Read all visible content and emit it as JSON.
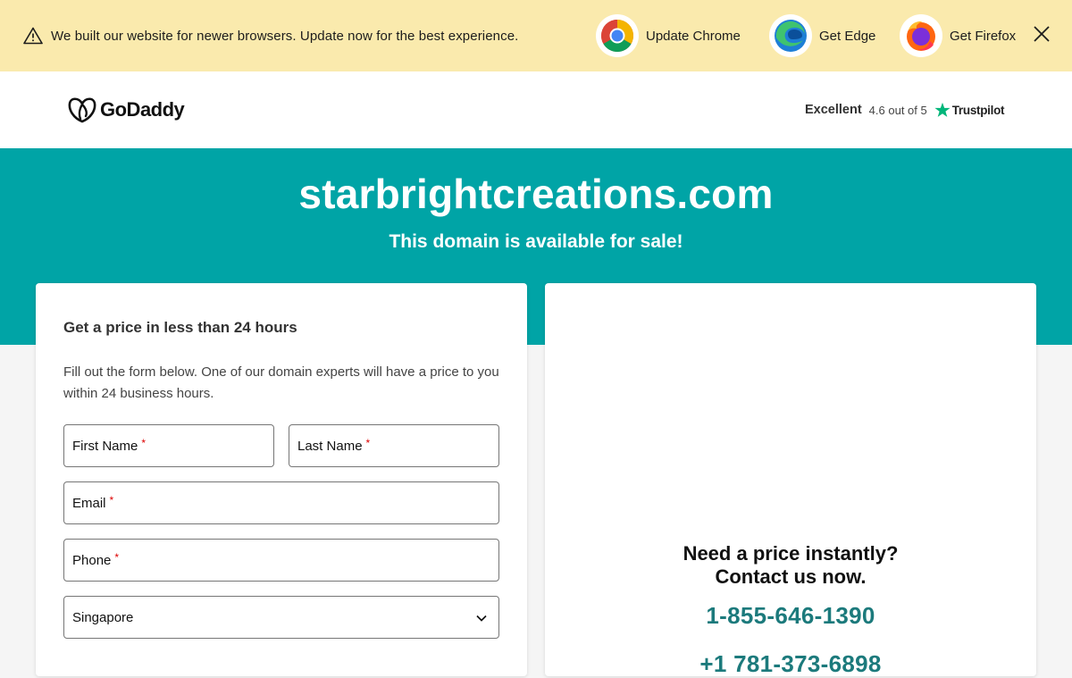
{
  "banner": {
    "message": "We built our website for newer browsers. Update now for the best experience.",
    "chrome_label": "Update Chrome",
    "edge_label": "Get Edge",
    "firefox_label": "Get Firefox"
  },
  "header": {
    "logo_text": "GoDaddy",
    "trustpilot": {
      "excellent": "Excellent",
      "rating": "4.6 out of 5",
      "brand": "Trustpilot",
      "star_color": "#00b67a"
    }
  },
  "hero": {
    "domain": "starbrightcreations.com",
    "subtitle": "This domain is available for sale!",
    "color": "#00a4a6"
  },
  "form": {
    "title": "Get a price in less than 24 hours",
    "description": "Fill out the form below. One of our domain experts will have a price to you within 24 business hours.",
    "first_name": "First Name",
    "last_name": "Last Name",
    "email": "Email",
    "phone": "Phone",
    "required_mark": "*",
    "country": "Singapore"
  },
  "contact": {
    "line1": "Need a price instantly?",
    "line2": "Contact us now.",
    "phone1": "1-855-646-1390",
    "phone2": "+1 781-373-6898"
  }
}
